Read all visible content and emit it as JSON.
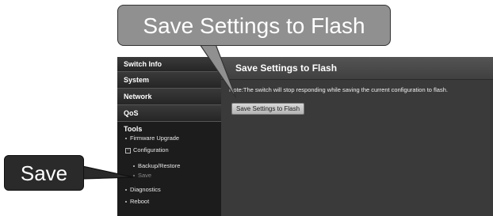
{
  "sidebar": {
    "items": [
      {
        "label": "Switch Info"
      },
      {
        "label": "System"
      },
      {
        "label": "Network"
      },
      {
        "label": "QoS"
      }
    ],
    "tools": {
      "label": "Tools",
      "firmware_upgrade": "Firmware Upgrade",
      "configuration": "Configuration",
      "configuration_toggle": "−",
      "backup_restore": "Backup/Restore",
      "save": "Save",
      "diagnostics": "Diagnostics",
      "reboot": "Reboot"
    }
  },
  "main": {
    "title": "Save Settings to Flash",
    "note": "Note:The switch will stop responding while saving the current configuration to flash.",
    "button_label": "Save Settings to Flash"
  },
  "callouts": {
    "top": "Save Settings to Flash",
    "left": "Save"
  },
  "colors": {
    "sidebar_bg": "#1c1c1c",
    "main_bg": "#3a3a3a",
    "callout_top_bg": "#909090",
    "callout_left_bg": "#2a2a2a"
  }
}
